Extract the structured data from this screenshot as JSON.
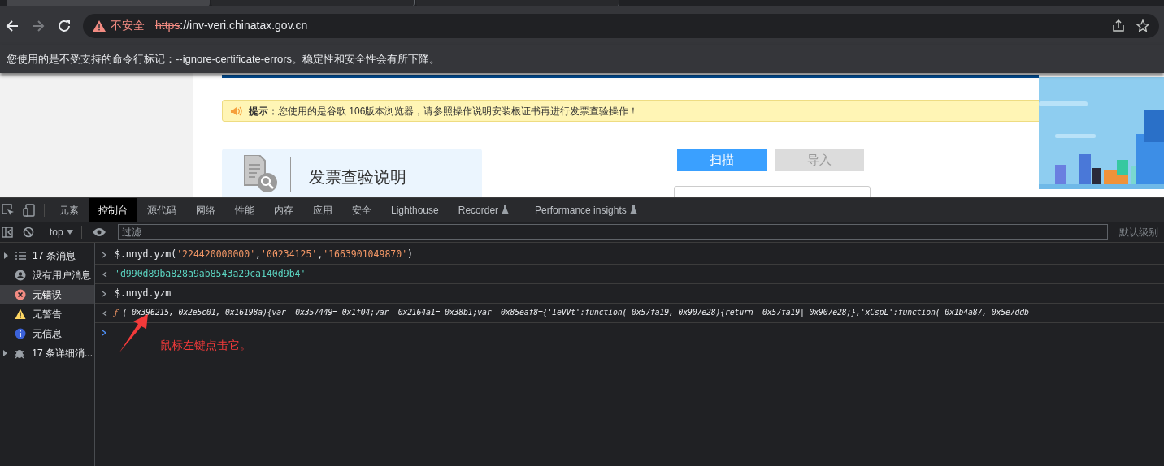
{
  "browser": {
    "tabs": [
      {
        "selected": true
      },
      {
        "selected": false
      },
      {
        "selected": false
      }
    ],
    "address": {
      "security": "不安全",
      "scheme": "https",
      "rest": "://inv-veri.chinatax.gov.cn"
    },
    "infobar": "您使用的是不受支持的命令行标记：--ignore-certificate-errors。稳定性和安全性会有所下降。"
  },
  "page": {
    "notice": "**提示：**您使用的是谷歌 106版本浏览器，请参照操作说明安装根证书再进行发票查验操作！",
    "help_card": "发票查验说明",
    "buttons": [
      {
        "label": "扫描",
        "disabled": false
      },
      {
        "label": "导入",
        "disabled": true
      }
    ]
  },
  "devtools": {
    "tabs": [
      {
        "label": "元素",
        "selected": false,
        "experimental": false
      },
      {
        "label": "控制台",
        "selected": true,
        "experimental": false
      },
      {
        "label": "源代码",
        "selected": false,
        "experimental": false
      },
      {
        "label": "网络",
        "selected": false,
        "experimental": false
      },
      {
        "label": "性能",
        "selected": false,
        "experimental": false
      },
      {
        "label": "内存",
        "selected": false,
        "experimental": false
      },
      {
        "label": "应用",
        "selected": false,
        "experimental": false
      },
      {
        "label": "安全",
        "selected": false,
        "experimental": false
      },
      {
        "label": "Lighthouse",
        "selected": false,
        "experimental": false
      },
      {
        "label": "Recorder",
        "selected": false,
        "experimental": true
      },
      {
        "label": "Performance insights",
        "selected": false,
        "experimental": true
      }
    ],
    "context": "top",
    "filter_placeholder": "过滤",
    "levels": "默认级别",
    "sidebar": [
      {
        "kind": "list",
        "label": "17 条消息",
        "selected": false,
        "expanded": false
      },
      {
        "kind": "user",
        "label": "没有用户消息",
        "selected": false
      },
      {
        "kind": "error",
        "label": "无错误",
        "selected": true
      },
      {
        "kind": "warning",
        "label": "无警告",
        "selected": false
      },
      {
        "kind": "info",
        "label": "无信息",
        "selected": false
      },
      {
        "kind": "bug",
        "label": "17 条详细消...",
        "selected": false,
        "expanded": false
      }
    ],
    "console": [
      {
        "kind": "input",
        "parts": [
          {
            "kind": "code",
            "text": "$.nnyd.yzm("
          },
          {
            "kind": "string",
            "text": "'224420000000'"
          },
          {
            "kind": "code",
            "text": ","
          },
          {
            "kind": "string",
            "text": "'00234125'"
          },
          {
            "kind": "code",
            "text": ","
          },
          {
            "kind": "string",
            "text": "'1663901049870'"
          },
          {
            "kind": "code",
            "text": ")"
          }
        ]
      },
      {
        "kind": "result",
        "parts": [
          {
            "kind": "result-string",
            "text": "'d990d89ba828a9ab8543a29ca140d9b4'"
          }
        ]
      },
      {
        "kind": "input",
        "parts": [
          {
            "kind": "code",
            "text": "$.nnyd.yzm"
          }
        ]
      },
      {
        "kind": "result",
        "parts": [
          {
            "kind": "function-mark",
            "text": "ƒ"
          },
          {
            "kind": "function",
            "text": "(_0x396215,_0x2e5c01,_0x16198a){var _0x357449=_0x1f04;var _0x2164a1=_0x38b1;var _0x85eaf8={'IeVVt':function(_0x57fa19,_0x907e28){return _0x57fa19|_0x907e28;},'xCspL':function(_0x1b4a87,_0x5e7ddb"
          }
        ]
      },
      {
        "kind": "prompt"
      }
    ],
    "annotation": "鼠标左键点击它。"
  }
}
